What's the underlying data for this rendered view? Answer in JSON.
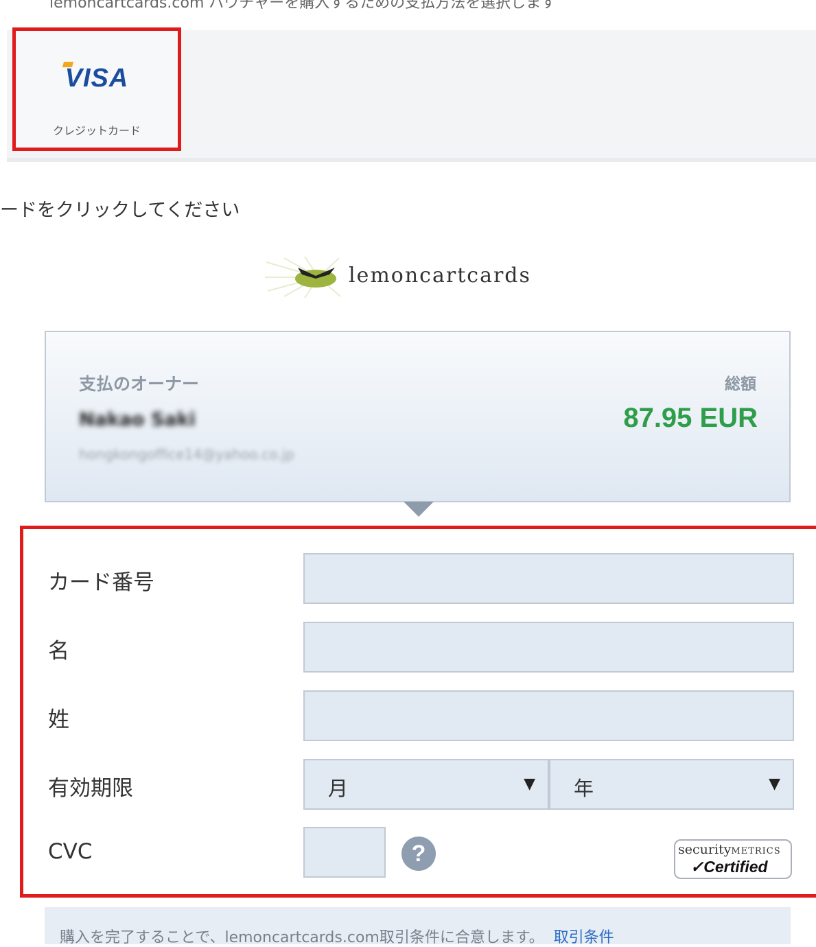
{
  "header": {
    "instruction_text": "lemoncartcards.com バウチャーを購入するための支払方法を選択します"
  },
  "payment_methods": [
    {
      "logo": "VISA",
      "label": "クレジットカード",
      "selected": true
    }
  ],
  "instruction": "ードをクリックしてください",
  "brand": {
    "name": "lemoncartcards"
  },
  "summary": {
    "owner_label": "支払のオーナー",
    "owner_name": "Nakao Saki",
    "owner_email": "hongkongoffice14@yahoo.co.jp",
    "total_label": "総額",
    "total_value": "87.95 EUR"
  },
  "form": {
    "card_number_label": "カード番号",
    "first_name_label": "名",
    "last_name_label": "姓",
    "expiry_label": "有効期限",
    "month_value": "月",
    "year_value": "年",
    "cvc_label": "CVC",
    "help_icon": "?",
    "badge_top": "security",
    "badge_top_small": "METRICS",
    "badge_bottom": "✓Certified"
  },
  "terms": {
    "text": "購入を完了することで、lemoncartcards.com取引条件に合意します。",
    "link": "取引条件"
  },
  "colors": {
    "highlight": "#e01b1b",
    "total": "#2e9e4a",
    "link": "#2b6cc4"
  }
}
